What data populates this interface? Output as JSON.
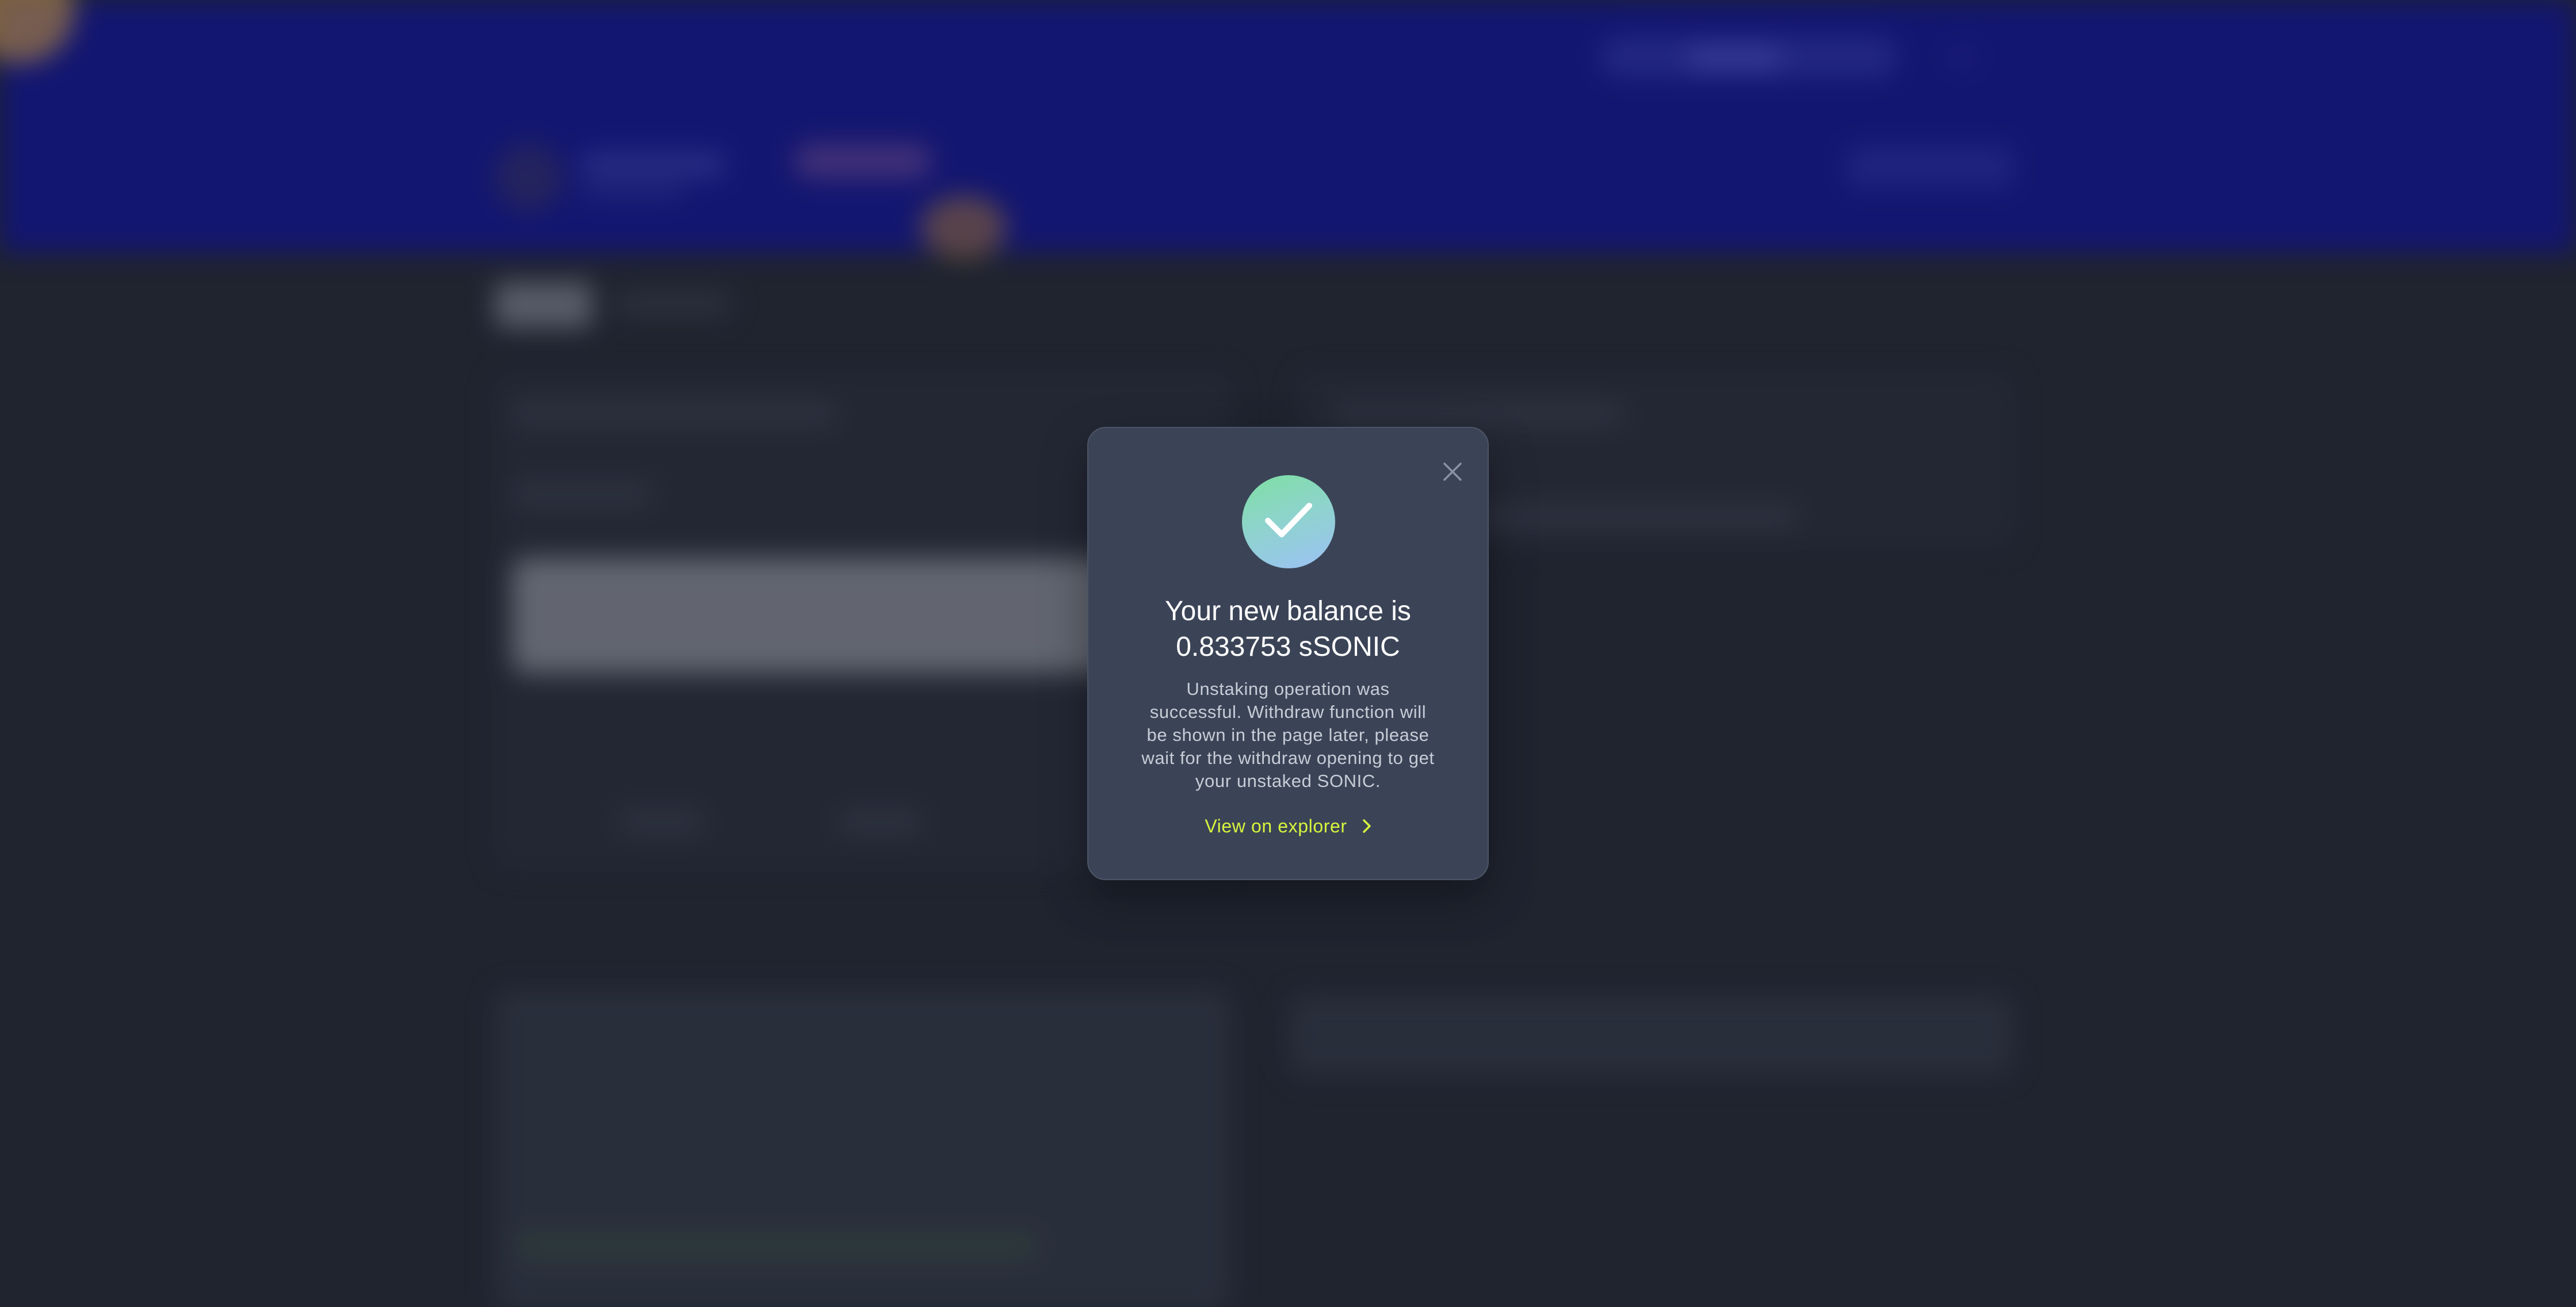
{
  "modal": {
    "title_line_1": "Your new balance is",
    "title_line_2": "0.833753 sSONIC",
    "message_lines": [
      "Unstaking operation was",
      "successful. Withdraw function will",
      "be shown in the page later, please",
      "wait for the withdraw opening to get",
      "your unstaked SONIC."
    ],
    "link_label": "View on explorer",
    "close_icon": "close-icon",
    "status_icon": "check-icon",
    "link_icon": "chevron-right-icon"
  },
  "colors": {
    "page_background": "#262b38",
    "header_background": "#13169b",
    "modal_background": "#3b4457",
    "link_accent": "#d8f53c",
    "success_gradient_start": "#7ee0a3",
    "success_gradient_end": "#9cc2f6"
  }
}
